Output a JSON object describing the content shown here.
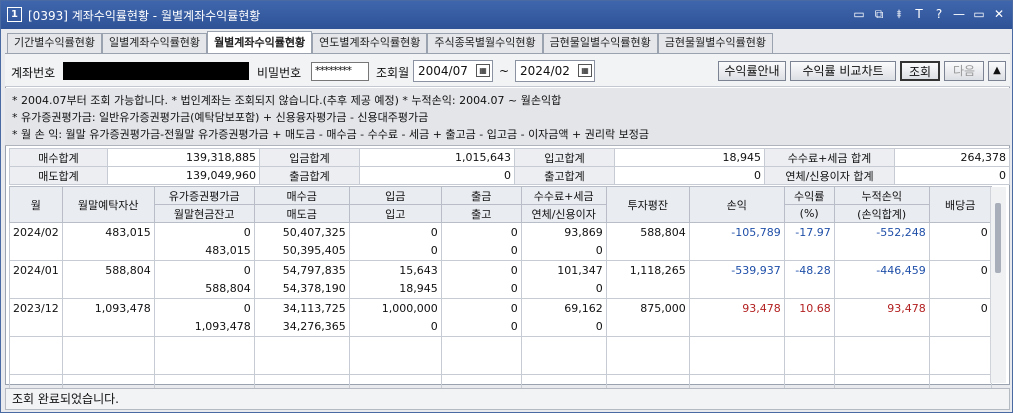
{
  "window": {
    "number": "1",
    "title": "[0393] 계좌수익률현황 - 월별계좌수익률현황"
  },
  "titlebar_icons": [
    "▭",
    "⧉",
    "⯒",
    "T",
    "?",
    "—",
    "▭",
    "✕"
  ],
  "tabs": [
    "기간별수익률현황",
    "일별계좌수익률현황",
    "월별계좌수익률현황",
    "연도별계좌수익률현황",
    "주식종목별월수익현황",
    "금현물일별수익률현황",
    "금현물월별수익률현황"
  ],
  "active_tab": 2,
  "query": {
    "account_label": "계좌번호",
    "account_value": "",
    "password_label": "비밀번호",
    "password_value": "********",
    "period_label": "조회월",
    "from": "2004/07",
    "tilde": "~",
    "to": "2024/02",
    "btn_guide": "수익률안내",
    "btn_chart": "수익률 비교차트",
    "btn_search": "조회",
    "btn_next": "다음",
    "btn_up": "▲"
  },
  "info_lines": [
    "* 2004.07부터 조회 가능합니다.   * 법인계좌는 조회되지 않습니다.(추후 제공 예정)   * 누적손익: 2004.07 ~ 월손익합",
    "* 유가증권평가금: 일반유가증권평가금(예탁담보포함) + 신용융자평가금 - 신용대주평가금",
    "* 월 손 익: 월말 유가증권평가금-전월말 유가증권평가금 + 매도금 - 매수금 - 수수료 - 세금 + 출고금 - 입고금 - 이자금액 + 권리락 보정금"
  ],
  "summary": [
    [
      "매수합계",
      "139,318,885",
      "입금합계",
      "1,015,643",
      "입고합계",
      "18,945",
      "수수료+세금 합계",
      "264,378"
    ],
    [
      "매도합계",
      "139,049,960",
      "출금합계",
      "0",
      "출고합계",
      "0",
      "연체/신용이자 합계",
      "0"
    ]
  ],
  "grid_headers": {
    "month": "월",
    "deposit": "월말예탁자산",
    "sec_top": "유가증권평가금",
    "sec_bot": "월말현금잔고",
    "buy_top": "매수금",
    "buy_bot": "매도금",
    "in_top": "입금",
    "in_bot": "입고",
    "out_top": "출금",
    "out_bot": "출고",
    "fee_top": "수수료+세금",
    "fee_bot": "연체/신용이자",
    "principal": "투자평잔",
    "pnl": "손익",
    "rate_top": "수익률",
    "rate_bot": "(%)",
    "cum_top": "누적손익",
    "cum_bot": "(손익합계)",
    "dividend": "배당금"
  },
  "rows": [
    {
      "month": "2024/02",
      "deposit": "483,015",
      "sec": "0",
      "cash": "483,015",
      "buy": "50,407,325",
      "sell": "50,395,405",
      "in": "0",
      "inq": "0",
      "out": "0",
      "outq": "0",
      "fee": "93,869",
      "interest": "0",
      "principal": "588,804",
      "pnl": "-105,789",
      "rate": "-17.97",
      "cum": "-552,248",
      "dividend": "0"
    },
    {
      "month": "2024/01",
      "deposit": "588,804",
      "sec": "0",
      "cash": "588,804",
      "buy": "54,797,835",
      "sell": "54,378,190",
      "in": "15,643",
      "inq": "18,945",
      "out": "0",
      "outq": "0",
      "fee": "101,347",
      "interest": "0",
      "principal": "1,118,265",
      "pnl": "-539,937",
      "rate": "-48.28",
      "cum": "-446,459",
      "dividend": "0"
    },
    {
      "month": "2023/12",
      "deposit": "1,093,478",
      "sec": "0",
      "cash": "1,093,478",
      "buy": "34,113,725",
      "sell": "34,276,365",
      "in": "1,000,000",
      "inq": "0",
      "out": "0",
      "outq": "0",
      "fee": "69,162",
      "interest": "0",
      "principal": "875,000",
      "pnl": "93,478",
      "rate": "10.68",
      "cum": "93,478",
      "dividend": "0"
    }
  ],
  "status": "조회 완료되었습니다."
}
